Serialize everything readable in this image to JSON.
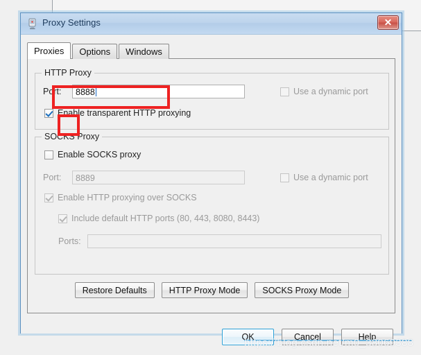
{
  "window": {
    "title": "Proxy Settings",
    "icon": "proxy-settings-icon",
    "close_label": "Close"
  },
  "tabs": [
    {
      "label": "Proxies",
      "active": true
    },
    {
      "label": "Options",
      "active": false
    },
    {
      "label": "Windows",
      "active": false
    }
  ],
  "http_proxy": {
    "group_title": "HTTP Proxy",
    "port_label": "Port:",
    "port_value": "8888",
    "dynamic_port_label": "Use a dynamic port",
    "dynamic_port_checked": false,
    "transparent_label": "Enable transparent HTTP proxying",
    "transparent_checked": true
  },
  "socks_proxy": {
    "group_title": "SOCKS Proxy",
    "enable_label": "Enable SOCKS proxy",
    "enable_checked": false,
    "port_label": "Port:",
    "port_value": "8889",
    "dynamic_port_label": "Use a dynamic port",
    "dynamic_port_checked": false,
    "http_over_socks_label": "Enable HTTP proxying over SOCKS",
    "http_over_socks_checked": true,
    "include_defaults_label": "Include default HTTP ports (80, 443, 8080, 8443)",
    "include_defaults_checked": true,
    "ports_label": "Ports:",
    "ports_value": "",
    "ports_placeholder": ""
  },
  "mid_buttons": [
    {
      "label": "Restore Defaults"
    },
    {
      "label": "HTTP Proxy Mode"
    },
    {
      "label": "SOCKS Proxy Mode"
    }
  ],
  "dialog_buttons": [
    {
      "label": "OK",
      "default": true
    },
    {
      "label": "Cancel",
      "default": false
    },
    {
      "label": "Help",
      "default": false
    }
  ],
  "annotations": {
    "port_box_color": "#ee2222",
    "checkbox_box_color": "#ee2222"
  },
  "watermark": {
    "text": "https://blog.csdn.net/m0_38069388"
  }
}
